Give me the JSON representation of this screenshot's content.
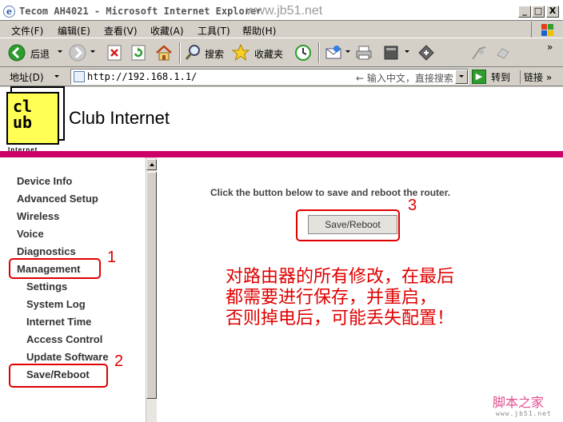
{
  "window": {
    "title": "Tecom AH4021 - Microsoft Internet Explorer",
    "watermark": "www.jb51.net",
    "minimize_label": "_",
    "maximize_label": "□",
    "close_label": "X"
  },
  "menu": [
    "文件(F)",
    "编辑(E)",
    "查看(V)",
    "收藏(A)",
    "工具(T)",
    "帮助(H)"
  ],
  "toolbar": {
    "back_label": "后退",
    "search_label": "搜索",
    "favorites_label": "收藏夹",
    "more_label": "»"
  },
  "address": {
    "label": "地址(D)",
    "url": "http://192.168.1.1/",
    "hint": "← 输入中文，直接搜索",
    "go_label": "转到",
    "links_label": "链接 »"
  },
  "header": {
    "logo_text_line1": "cl",
    "logo_text_line2": "ub",
    "logo_sub": "Internet",
    "brand": "Club Internet"
  },
  "nav": {
    "device_info": "Device Info",
    "advanced_setup": "Advanced Setup",
    "wireless": "Wireless",
    "voice": "Voice",
    "diagnostics": "Diagnostics",
    "management": "Management",
    "settings": "Settings",
    "system_log": "System Log",
    "internet_time": "Internet Time",
    "access_control": "Access Control",
    "update_software": "Update Software",
    "save_reboot": "Save/Reboot"
  },
  "main": {
    "instruction": "Click the button below to save and reboot the router.",
    "button_label": "Save/Reboot"
  },
  "annotations": {
    "step1": "1",
    "step2": "2",
    "step3": "3",
    "note_line1": "对路由器的所有修改，在最后",
    "note_line2": "都需要进行保存，并重启，",
    "note_line3": "否则掉电后，可能丢失配置！",
    "color": "#e00000"
  },
  "footer_logo": {
    "text": "脚本之家",
    "url": "www.jb51.net"
  },
  "colors": {
    "accent_rule": "#cc0066",
    "logo_yellow": "#ffff55"
  }
}
